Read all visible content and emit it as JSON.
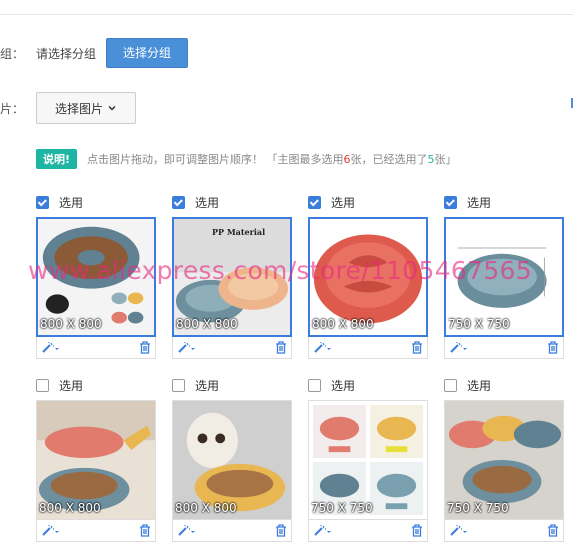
{
  "group": {
    "label": "组：",
    "hint": "请选择分组",
    "button_label": "选择分组"
  },
  "image": {
    "label": "片：",
    "select_button_label": "选择图片"
  },
  "notice": {
    "badge": "说明!",
    "text_before": "点击图片拖动，即可调整图片顺序！ 「主图最多选用",
    "max_count": "6",
    "text_middle": "张，已经选用了",
    "used_count": "5",
    "text_after": "张」"
  },
  "watermark": "www.aliexpress.com/store/1105467565",
  "select_label": "选用",
  "row1": [
    {
      "size": "800 X 800",
      "checked": true
    },
    {
      "size": "800 X 800",
      "checked": true,
      "caption": "PP Material"
    },
    {
      "size": "800 X 800",
      "checked": true
    },
    {
      "size": "750 X 750",
      "checked": true
    }
  ],
  "row2": [
    {
      "size": "800 X 800",
      "checked": false
    },
    {
      "size": "800 X 800",
      "checked": false
    },
    {
      "size": "750 X 750",
      "checked": false
    },
    {
      "size": "750 X 750",
      "checked": false
    }
  ],
  "icons": {
    "magic": "magic-wand-icon",
    "trash": "trash-icon",
    "chevron": "chevron-down-icon"
  },
  "colors": {
    "primary": "#4a90d9",
    "checkbox": "#3b7ddd",
    "badge": "#1fb5a3",
    "highlight_red": "#e23b3b",
    "watermark": "#e82882"
  }
}
